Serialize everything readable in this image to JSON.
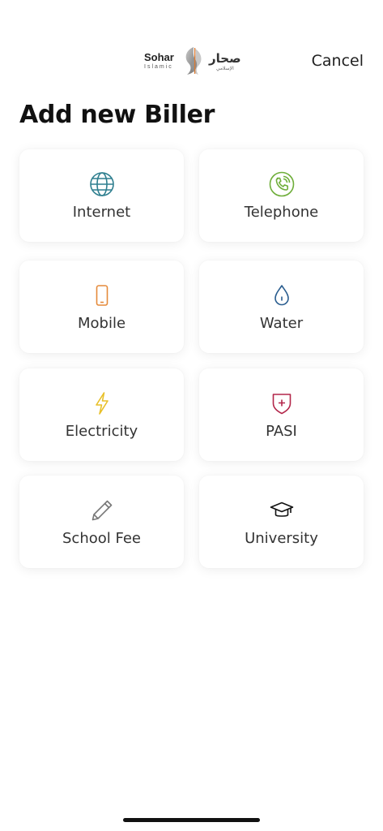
{
  "header": {
    "logo_en_primary": "Sohar",
    "logo_en_secondary": "Islamic",
    "logo_ar_primary": "صحار",
    "logo_ar_secondary": "الإسلامي",
    "cancel_label": "Cancel"
  },
  "page_title": "Add new Biller",
  "billers": [
    {
      "label": "Internet",
      "icon": "globe-icon",
      "color": "#2f7f8f"
    },
    {
      "label": "Telephone",
      "icon": "phone-icon",
      "color": "#6fae3a"
    },
    {
      "label": "Mobile",
      "icon": "mobile-icon",
      "color": "#e58a3a"
    },
    {
      "label": "Water",
      "icon": "water-drop-icon",
      "color": "#2a5d8f"
    },
    {
      "label": "Electricity",
      "icon": "lightning-icon",
      "color": "#e8c02a"
    },
    {
      "label": "PASI",
      "icon": "shield-plus-icon",
      "color": "#b3264a"
    },
    {
      "label": "School Fee",
      "icon": "pencil-icon",
      "color": "#777777"
    },
    {
      "label": "University",
      "icon": "graduation-cap-icon",
      "color": "#111111"
    }
  ]
}
